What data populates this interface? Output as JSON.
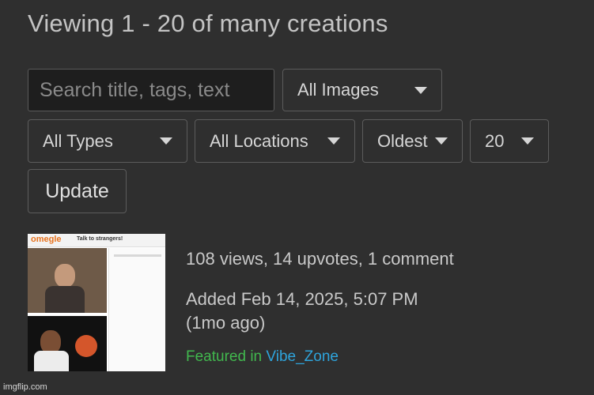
{
  "heading": "Viewing 1 - 20 of many creations",
  "search": {
    "placeholder": "Search title, tags, text"
  },
  "filters": {
    "image_filter": "All Images",
    "type_filter": "All Types",
    "location_filter": "All Locations",
    "sort": "Oldest",
    "per_page": "20"
  },
  "update_button": "Update",
  "thumbnail": {
    "site_name": "omegle",
    "tagline": "Talk to strangers!"
  },
  "post": {
    "stats": "108 views, 14 upvotes, 1 comment",
    "added_line1": "Added Feb 14, 2025, 5:07 PM",
    "added_line2": "(1mo ago)",
    "featured_prefix": "Featured in",
    "featured_stream": "Vibe_Zone"
  },
  "colors": {
    "background": "#2f2f2f",
    "featured_green": "#41b84e",
    "link_blue": "#2ea4dc"
  },
  "watermark": "imgflip.com"
}
